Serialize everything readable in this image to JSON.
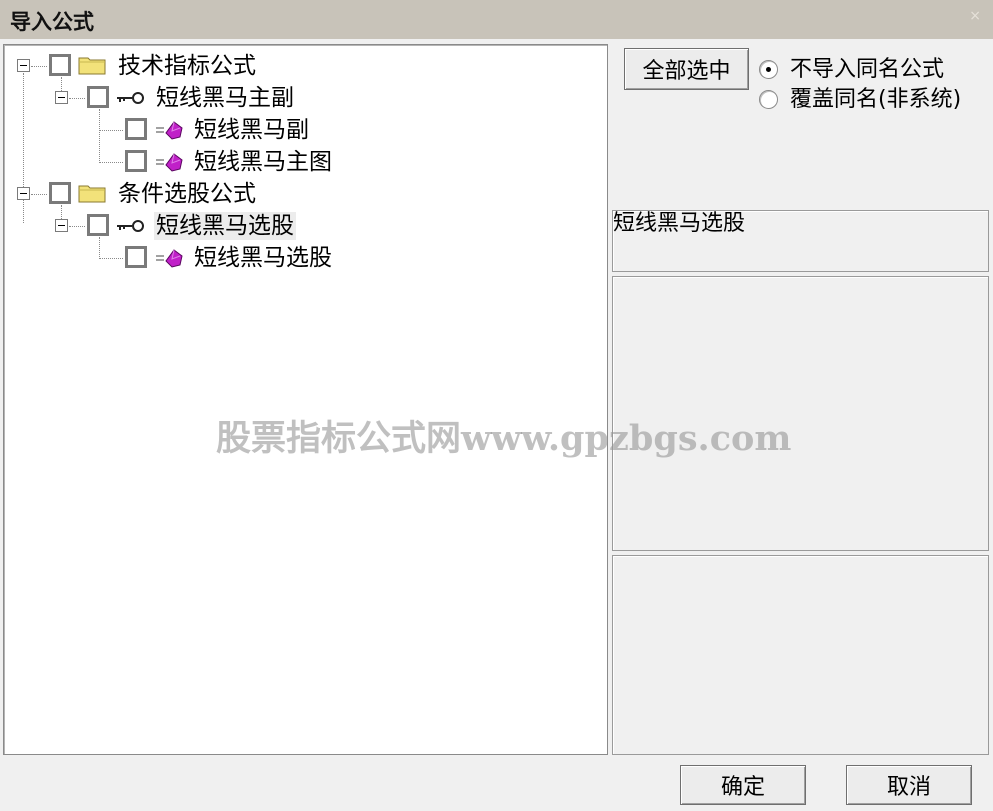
{
  "window": {
    "title": "导入公式",
    "close_glyph": "×"
  },
  "tree": {
    "groups": [
      {
        "label": "技术指标公式",
        "icon": "folder-icon",
        "checked": false,
        "children": [
          {
            "label": "短线黑马主副",
            "icon": "key-icon",
            "checked": false,
            "children": [
              {
                "label": "短线黑马副",
                "icon": "gem-icon",
                "checked": false
              },
              {
                "label": "短线黑马主图",
                "icon": "gem-icon",
                "checked": false
              }
            ]
          }
        ]
      },
      {
        "label": "条件选股公式",
        "icon": "folder-icon",
        "checked": false,
        "children": [
          {
            "label": "短线黑马选股",
            "icon": "key-icon",
            "checked": false,
            "selected": true,
            "children": [
              {
                "label": "短线黑马选股",
                "icon": "gem-icon",
                "checked": false
              }
            ]
          }
        ]
      }
    ]
  },
  "options": {
    "select_all_label": "全部选中",
    "radio_options": [
      {
        "label": "不导入同名公式",
        "checked": true
      },
      {
        "label": "覆盖同名(非系统)",
        "checked": false
      }
    ]
  },
  "details": {
    "formula_name": "短线黑马选股",
    "description": "",
    "parameters": ""
  },
  "footer": {
    "ok_label": "确定",
    "cancel_label": "取消"
  },
  "watermark": "股票指标公式网www.gpzbgs.com",
  "colors": {
    "titlebar": "#c8c3b9",
    "folder_yellow": "#f2e27a",
    "gem_magenta": "#c020c8"
  }
}
